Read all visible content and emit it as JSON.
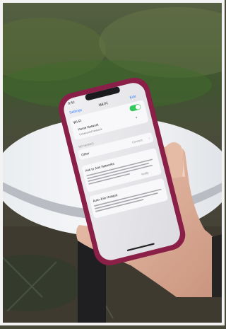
{
  "phone": {
    "status_time": "9:41",
    "back_label": "Settings",
    "nav_title": "Wi-Fi",
    "edit_label": "Edit",
    "wifi_label": "Wi-Fi",
    "connected_network": "Home Network",
    "security_note": "Unsecured Network",
    "section_networks": "NETWORKS",
    "network_row": "Other",
    "network_detail": "Connect",
    "ask_title": "Ask to Join Networks",
    "ask_value": "Notify",
    "hotspot_title": "Auto-Join Hotspot",
    "wifi_on": true
  },
  "colors": {
    "phone_case": "#8a1f47",
    "screen": "#e9e9ec",
    "toggle_on": "#34c759",
    "tabletop": "#f1f2f4",
    "foliage": "#3d5a2a",
    "skin": "#e1b49d"
  }
}
